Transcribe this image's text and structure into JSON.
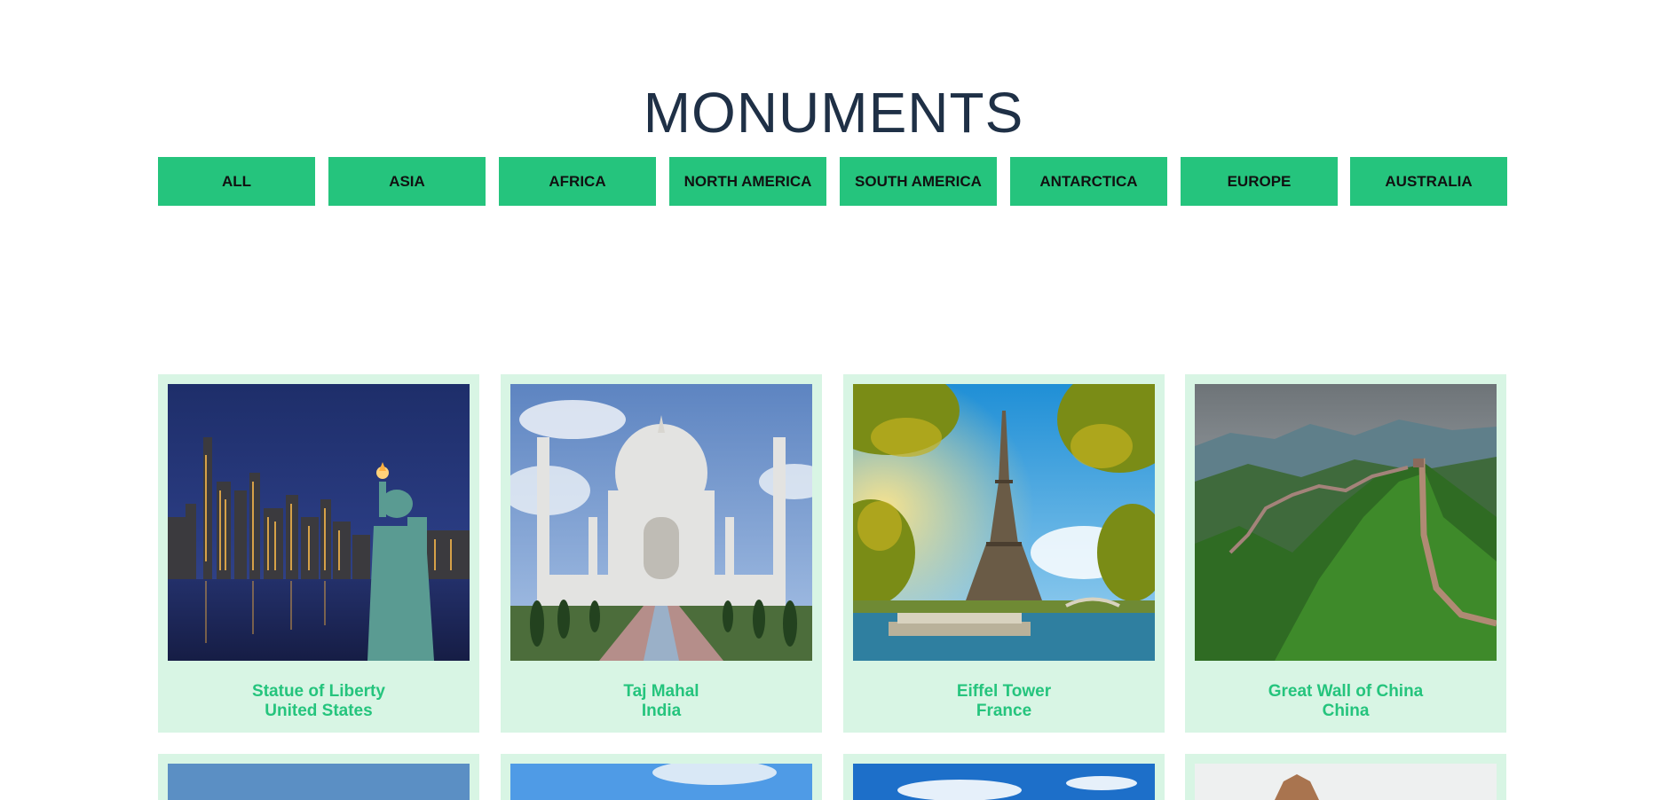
{
  "page": {
    "title": "MONUMENTS"
  },
  "filters": [
    {
      "label": "ALL"
    },
    {
      "label": "ASIA"
    },
    {
      "label": "AFRICA"
    },
    {
      "label": "NORTH AMERICA"
    },
    {
      "label": "SOUTH AMERICA"
    },
    {
      "label": "ANTARCTICA"
    },
    {
      "label": "EUROPE"
    },
    {
      "label": "AUSTRALIA"
    }
  ],
  "monuments": [
    {
      "name": "Statue of Liberty",
      "country": "United States",
      "image": "statue-of-liberty-photo"
    },
    {
      "name": "Taj Mahal",
      "country": "India",
      "image": "taj-mahal-photo"
    },
    {
      "name": "Eiffel Tower",
      "country": "France",
      "image": "eiffel-tower-photo"
    },
    {
      "name": "Great Wall of China",
      "country": "China",
      "image": "great-wall-photo"
    }
  ],
  "colors": {
    "accent": "#25c47d",
    "card_background": "#d8f5e4",
    "title": "#1f3046"
  }
}
